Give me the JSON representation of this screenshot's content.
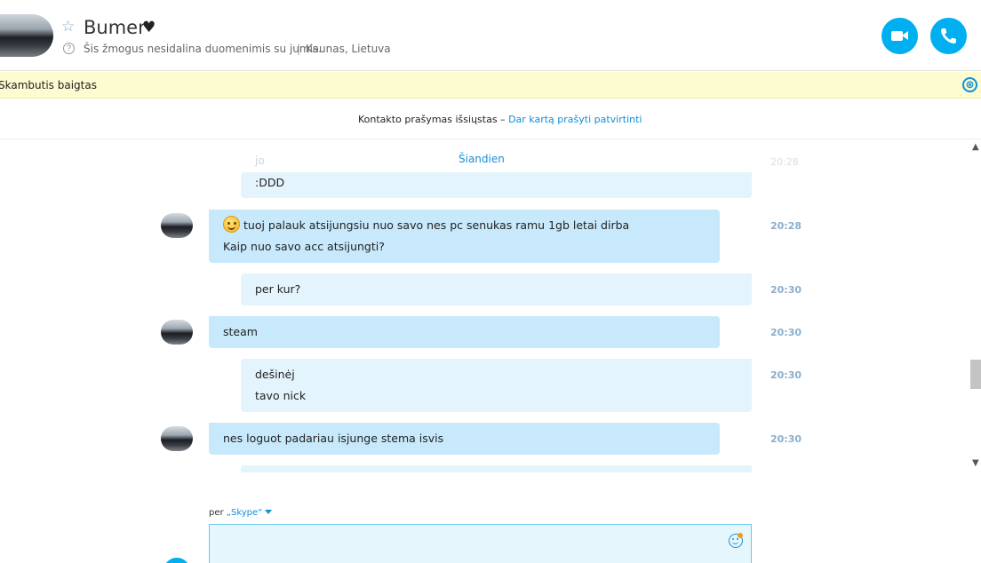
{
  "header": {
    "contact_name": "Bumer",
    "heart": "♥",
    "star_icon": "☆",
    "help_icon": "?",
    "privacy_text": "Šis žmogus nesidalina duomenimis su jumis.",
    "separator": "|",
    "location": "Kaunas, Lietuva",
    "video_call_icon": "video-camera-icon",
    "voice_call_icon": "phone-icon",
    "accent_color": "#00aff0"
  },
  "banner": {
    "text": "Skambutis baigtas",
    "close_icon": "⊗",
    "background": "#fdfbd0"
  },
  "request": {
    "text": "Kontakto prašymas išsiųstas – ",
    "link": "Dar kartą prašyti patvirtinti"
  },
  "chat": {
    "date_divider": "Šiandien",
    "ghost_line": "jo",
    "ghost_time": "20:28",
    "messages": [
      {
        "direction": "out",
        "lines": [
          ":DDD"
        ],
        "time": ""
      },
      {
        "direction": "in",
        "emoji": "smile-icon",
        "lines": [
          "tuoj palauk atsijungsiu nuo savo nes pc senukas ramu 1gb letai dirba",
          "Kaip nuo savo acc atsijungti?"
        ],
        "time": "20:28"
      },
      {
        "direction": "out",
        "lines": [
          "per kur?"
        ],
        "time": "20:30"
      },
      {
        "direction": "in",
        "lines": [
          "steam"
        ],
        "time": "20:30"
      },
      {
        "direction": "out",
        "lines": [
          "dešinėj",
          "tavo nick"
        ],
        "time": "20:30"
      },
      {
        "direction": "in",
        "lines": [
          "nes loguot padariau isjunge stema isvis"
        ],
        "time": "20:30"
      }
    ]
  },
  "scrollbar": {
    "up": "▲",
    "down": "▼"
  },
  "composer": {
    "via_prefix": "per ",
    "via_service": "„Skype“",
    "value": "",
    "placeholder": "",
    "emoticon_icon": "smiley-icon"
  }
}
